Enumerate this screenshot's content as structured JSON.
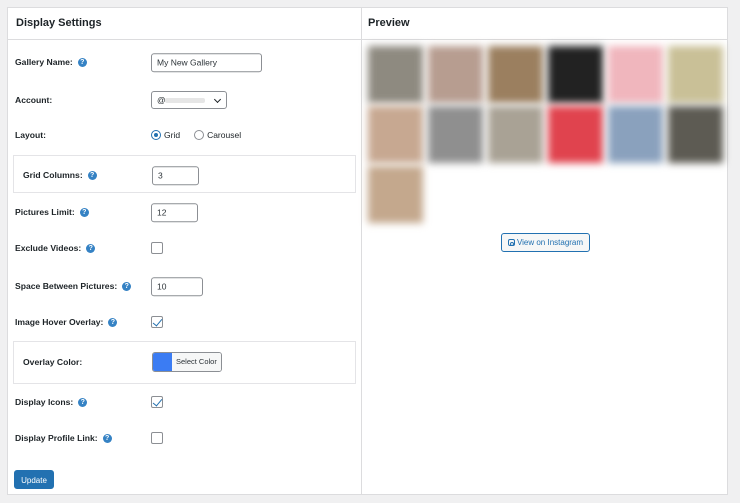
{
  "settings": {
    "title": "Display Settings",
    "gallery_name": {
      "label": "Gallery Name:",
      "value": "My New Gallery"
    },
    "account": {
      "label": "Account:",
      "value": "@"
    },
    "layout": {
      "label": "Layout:",
      "options": [
        "Grid",
        "Carousel"
      ],
      "selected": "Grid"
    },
    "grid_columns": {
      "label": "Grid Columns:",
      "value": "3"
    },
    "pictures_limit": {
      "label": "Pictures Limit:",
      "value": "12"
    },
    "exclude_videos": {
      "label": "Exclude Videos:",
      "checked": false
    },
    "space_between": {
      "label": "Space Between Pictures:",
      "value": "10"
    },
    "hover_overlay": {
      "label": "Image Hover Overlay:",
      "checked": true
    },
    "overlay_color": {
      "label": "Overlay Color:",
      "button": "Select Color",
      "color": "#3b7cf3"
    },
    "display_icons": {
      "label": "Display Icons:",
      "checked": true
    },
    "display_profile_link": {
      "label": "Display Profile Link:",
      "checked": false
    },
    "update_button": "Update",
    "help_icon": "?"
  },
  "preview": {
    "title": "Preview",
    "view_button": "View on Instagram",
    "thumb_colors": [
      "#8e8a80",
      "#b79d90",
      "#9b7f5f",
      "#222222",
      "#f0b6bd",
      "#c9c097",
      "#c7a891",
      "#8f8f8f",
      "#a9a295",
      "#e0434e",
      "#8aa1bd",
      "#5d5b53",
      "#c4a88d"
    ]
  }
}
